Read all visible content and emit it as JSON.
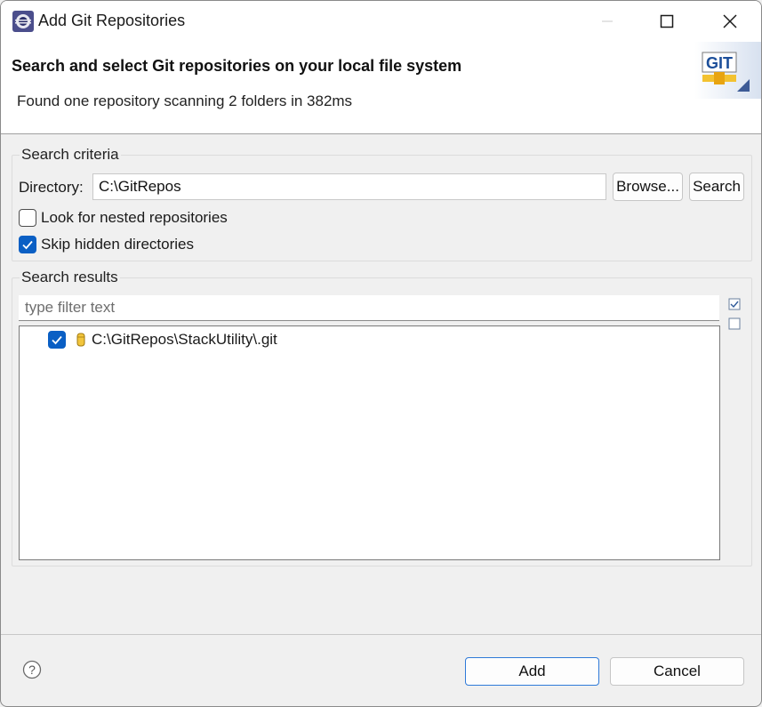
{
  "window": {
    "title": "Add Git Repositories",
    "controls": [
      "minimize",
      "maximize",
      "close"
    ]
  },
  "header": {
    "title": "Search and select Git repositories on your local file system",
    "message": "Found one repository scanning 2 folders in 382ms",
    "banner_text": "GIT"
  },
  "search_criteria": {
    "group_label": "Search criteria",
    "directory_label": "Directory:",
    "directory_value": "C:\\GitRepos",
    "browse_label": "Browse...",
    "search_label": "Search",
    "nested_label": "Look for nested repositories",
    "nested_checked": false,
    "hidden_label": "Skip hidden directories",
    "hidden_checked": true
  },
  "search_results": {
    "group_label": "Search results",
    "filter_placeholder": "type filter text",
    "filter_value": "",
    "items": [
      {
        "label": "C:\\GitRepos\\StackUtility\\.git",
        "checked": true
      }
    ]
  },
  "footer": {
    "add_label": "Add",
    "cancel_label": "Cancel"
  },
  "colors": {
    "accent": "#0a5fc4",
    "window_bg": "#f0f0f0",
    "header_bg": "#ffffff"
  }
}
